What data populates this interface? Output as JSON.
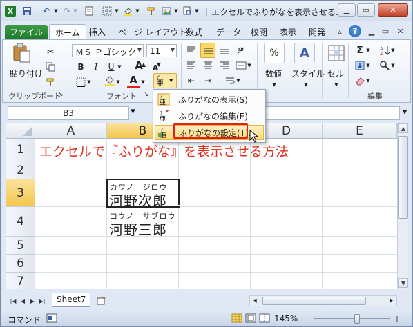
{
  "window": {
    "title": "エクセルでふりがなを表示させる...",
    "minimize_icon": "minimize-icon",
    "restore_icon": "restore-icon",
    "close_icon": "close-icon"
  },
  "ribbon_tabs": {
    "file": "ファイル",
    "items": [
      "ホーム",
      "挿入",
      "ページ レイアウト",
      "数式",
      "データ",
      "校閲",
      "表示",
      "開発"
    ],
    "active": "ホーム"
  },
  "ribbon": {
    "clipboard": {
      "paste": "貼り付け",
      "group": "クリップボード"
    },
    "font": {
      "font_name": "ＭＳ Ｐゴシック",
      "font_size": "11",
      "bold": "B",
      "italic": "I",
      "underline": "U",
      "group": "フォント",
      "grow": "A",
      "shrink": "A",
      "font_color_label": "A",
      "font_color": "#e0201a",
      "fill_color": "#f7e13b"
    },
    "number": {
      "label": "数値",
      "percent": "%"
    },
    "styles": {
      "label": "スタイル",
      "icon_letter": "A"
    },
    "cells": {
      "label": "セル"
    },
    "editing": {
      "label": "編集",
      "sigma": "Σ"
    }
  },
  "formula_bar": {
    "name_box": "B3",
    "fx": "fx"
  },
  "furigana_menu": {
    "items": [
      {
        "label": "ふりがなの表示(S)"
      },
      {
        "label": "ふりがなの編集(E)"
      },
      {
        "label": "ふりがなの設定(T)..."
      }
    ],
    "highlighted_index": 2
  },
  "sheet": {
    "columns": [
      "A",
      "B",
      "C",
      "D",
      "E"
    ],
    "selected_column": "B",
    "rows": [
      "1",
      "2",
      "3",
      "4",
      "5",
      "6",
      "7"
    ],
    "selected_row": "3",
    "title_text": "エクセルで『ふりがな』を表示させる方法",
    "cells": {
      "b3_furigana": "カワノ　ジロウ",
      "b3_text": "河野次郎",
      "b4_furigana": "コウノ　サブロウ",
      "b4_text": "河野三郎"
    },
    "sheet_tab": "Sheet7"
  },
  "status_bar": {
    "mode": "コマンド",
    "zoom": "145%",
    "zoom_minus": "－",
    "zoom_plus": "＋"
  }
}
